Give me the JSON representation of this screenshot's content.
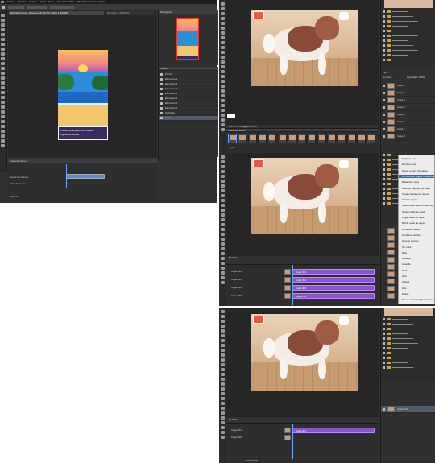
{
  "main_window": {
    "title": "Sin título-1 @ 66,7% (Capa 1, RGB/8)",
    "menu": [
      "Archivo",
      "Edición",
      "Imagen",
      "Capa",
      "Texto",
      "Selección",
      "Filtro",
      "3D",
      "Vista",
      "Ventana",
      "Ayuda"
    ],
    "tabs": [
      "Ilustración-píxel_playa.psd @ 66,7% (Capa 1, RGB/8)",
      "Sin título-1 @ 66,7%"
    ],
    "panels": {
      "navigator": "Navegador",
      "layers": "Capas",
      "timeline": "Línea de tiempo"
    },
    "layers": [
      "Fondo",
      "Elemento 1",
      "Elemento 2",
      "Elemento 3",
      "Elemento 4",
      "Elemento 5",
      "Elemento 6",
      "Elemento 7",
      "Subtítulo",
      "Capa 1"
    ],
    "dialog_text": [
      "Pulsa «Continuar» para seguir.",
      "Siguiente escena"
    ],
    "timeline_rows": [
      "Grupo de vídeo 1",
      "Pista de audio"
    ],
    "zoom": "66,67%"
  },
  "panels_right": [
    {
      "status": "66,67% (1 fotograma, 0 s)",
      "layers": [
        "Capa 1",
        "Capa 2",
        "Capa 3",
        "Capa 4",
        "Capa 5",
        "Capa 6",
        "Capa 7",
        "Capa 8"
      ],
      "timeline_label": "Línea de tiempo",
      "frame_delay": "0,5 s",
      "layer_filter": "Tipo",
      "blend_mode": "Normal",
      "opacity_label": "Opacidad: 100%"
    },
    {
      "status": "66,67%",
      "tracks": [
        "Capa 302",
        "Capa 301",
        "Capa 300",
        "Capa 299"
      ],
      "clip_label": "Capa 302",
      "context_menu": [
        "Duplicar capa...",
        "Eliminar capa",
        "Grupo a partir de capas...",
        "Convertir en objeto inteligente",
        "Rasterizar capa",
        "Habilitar máscara de capa",
        "Crear máscara de recorte",
        "Enlazar capas",
        "Seleccionar capas enlazadas",
        "Copiar estilo de capa",
        "Pegar estilo de capa",
        "Borrar estilo de capa",
        "Combinar capas",
        "Combinar visibles",
        "Acoplar imagen",
        "Sin color",
        "Rojo",
        "Naranja",
        "Amarillo",
        "Verde",
        "Azul",
        "Violeta",
        "Gris",
        "Postal",
        "Nuevo extrusión 3D a partir de capa seleccionada"
      ],
      "context_selected": "Convertir en objeto inteligente"
    },
    {
      "status": "66,67%",
      "tracks": [
        "Capa 301",
        "Capa 300"
      ],
      "clip_label": "Capa 301",
      "timecode": "0:00:00:00",
      "layers": [
        "Capa 301"
      ]
    }
  ],
  "colors": {
    "clip": "#8a56c8",
    "accent": "#2a67d8",
    "canvas": "#262626",
    "panel": "#323232"
  }
}
